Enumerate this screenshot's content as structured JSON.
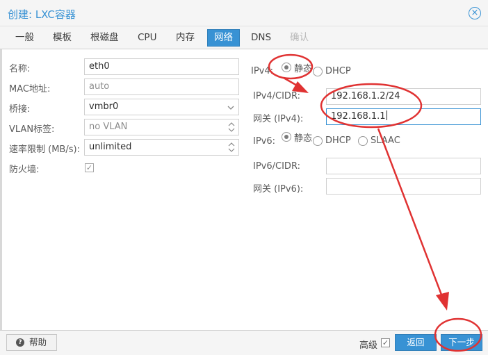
{
  "dialog": {
    "title": "创建: LXC容器",
    "close_icon": "×"
  },
  "tabs": [
    {
      "label": "一般",
      "state": "normal"
    },
    {
      "label": "模板",
      "state": "normal"
    },
    {
      "label": "根磁盘",
      "state": "normal"
    },
    {
      "label": "CPU",
      "state": "normal"
    },
    {
      "label": "内存",
      "state": "normal"
    },
    {
      "label": "网络",
      "state": "active"
    },
    {
      "label": "DNS",
      "state": "normal"
    },
    {
      "label": "确认",
      "state": "disabled"
    }
  ],
  "left": {
    "name": {
      "label": "名称:",
      "value": "eth0"
    },
    "mac": {
      "label": "MAC地址:",
      "value": "auto"
    },
    "bridge": {
      "label": "桥接:",
      "value": "vmbr0"
    },
    "vlan": {
      "label": "VLAN标签:",
      "value": "no VLAN"
    },
    "rate": {
      "label": "速率限制 (MB/s):",
      "value": "unlimited"
    },
    "firewall": {
      "label": "防火墙:",
      "checked": true,
      "check_glyph": "✓"
    }
  },
  "right": {
    "ipv4": {
      "label": "IPv4:",
      "static_label": "静态",
      "dhcp_label": "DHCP",
      "selected": "static",
      "cidr_label": "IPv4/CIDR:",
      "cidr_value": "192.168.1.2/24",
      "gw_label": "网关 (IPv4):",
      "gw_value": "192.168.1.1"
    },
    "ipv6": {
      "label": "IPv6:",
      "static_label": "静态",
      "dhcp_label": "DHCP",
      "slaac_label": "SLAAC",
      "selected": "static",
      "cidr_label": "IPv6/CIDR:",
      "cidr_value": "",
      "gw_label": "网关 (IPv6):",
      "gw_value": ""
    }
  },
  "footer": {
    "help_label": "帮助",
    "help_icon": "?",
    "advanced_label": "高级",
    "advanced_checked": true,
    "advanced_glyph": "✓",
    "back_label": "返回",
    "next_label": "下一步"
  },
  "colors": {
    "accent": "#3892d4",
    "annotation": "#e03232",
    "panel_bg": "#f5f5f5"
  },
  "icons": {
    "close": "close-icon",
    "dropdown": "chevron-down-icon",
    "spinner": "spinner-updown-icon",
    "help": "help-icon",
    "check": "checkmark-icon"
  }
}
